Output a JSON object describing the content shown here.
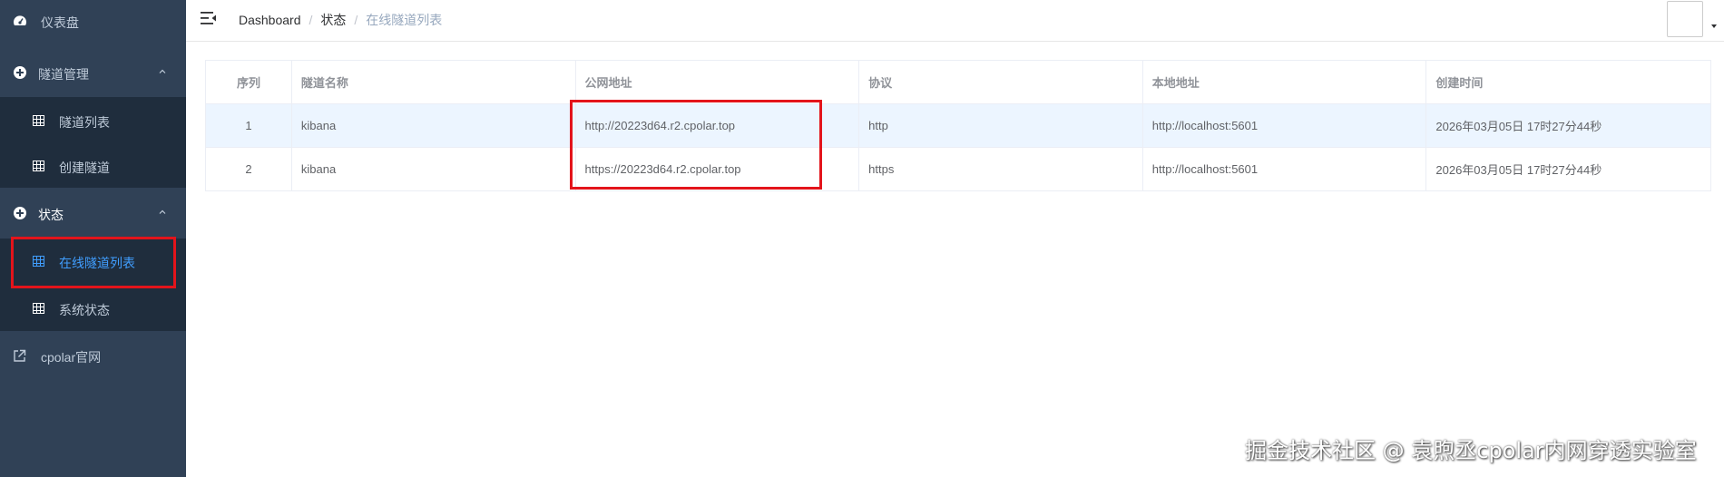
{
  "sidebar": {
    "items": [
      {
        "label": "仪表盘",
        "icon": "dashboard-icon"
      },
      {
        "label": "隧道管理",
        "icon": "circle-plus-icon",
        "expanded": true
      },
      {
        "label": "隧道列表",
        "icon": "table-icon"
      },
      {
        "label": "创建隧道",
        "icon": "table-icon"
      },
      {
        "label": "状态",
        "icon": "circle-plus-icon",
        "expanded": true
      },
      {
        "label": "在线隧道列表",
        "icon": "table-icon",
        "active": true
      },
      {
        "label": "系统状态",
        "icon": "table-icon"
      },
      {
        "label": "cpolar官网",
        "icon": "external-link-icon"
      }
    ]
  },
  "header": {
    "breadcrumb": [
      "Dashboard",
      "状态",
      "在线隧道列表"
    ],
    "separator": "/"
  },
  "table": {
    "columns": [
      "序列",
      "隧道名称",
      "公网地址",
      "协议",
      "本地地址",
      "创建时间"
    ],
    "rows": [
      [
        "1",
        "kibana",
        "http://20223d64.r2.cpolar.top",
        "http",
        "http://localhost:5601",
        "2026年03月05日 17时27分44秒"
      ],
      [
        "2",
        "kibana",
        "https://20223d64.r2.cpolar.top",
        "https",
        "http://localhost:5601",
        "2026年03月05日 17时27分44秒"
      ]
    ]
  },
  "colors": {
    "sidebar_bg": "#304156",
    "submenu_bg": "#1f2d3d",
    "active": "#409eff",
    "highlight": "#e3141b",
    "striped_row": "#ecf5ff"
  },
  "watermark": "掘金技术社区 @ 袁煦丞cpolar内网穿透实验室"
}
